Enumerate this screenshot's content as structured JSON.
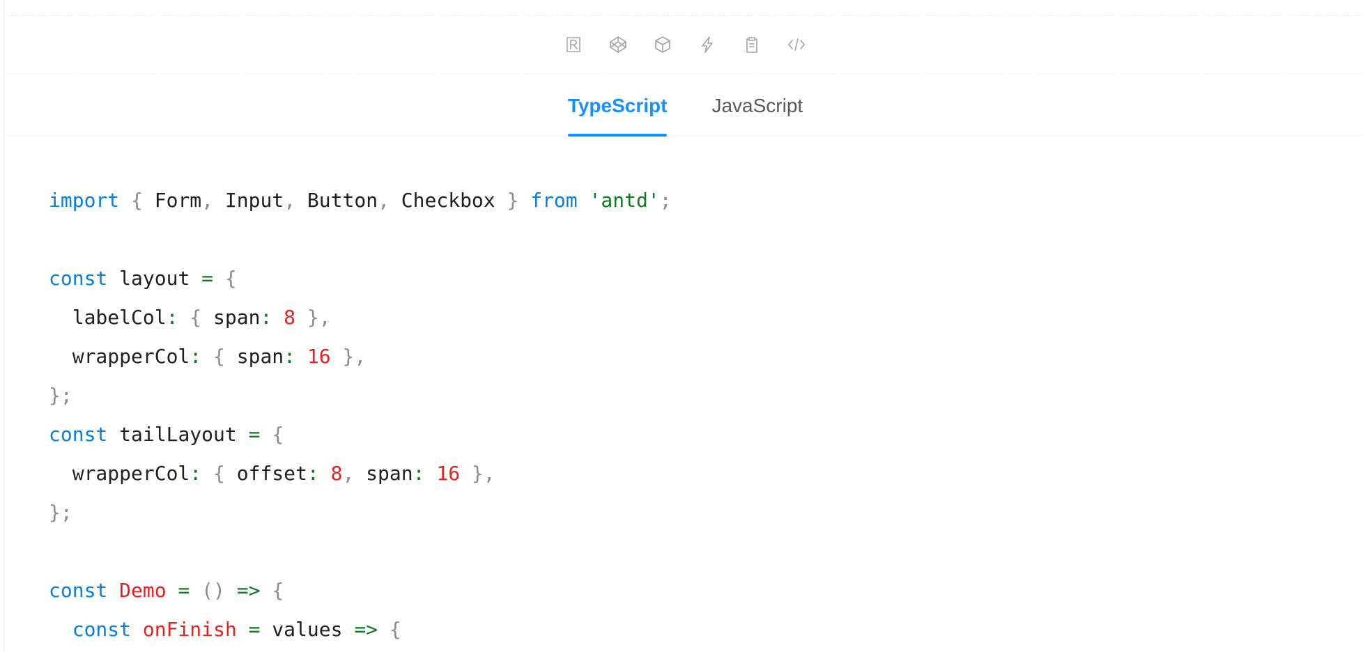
{
  "toolbar": {
    "icons": [
      {
        "name": "codesandbox-icon"
      },
      {
        "name": "codepen-icon"
      },
      {
        "name": "sandbox-box-icon"
      },
      {
        "name": "stackblitz-icon"
      },
      {
        "name": "copy-icon"
      },
      {
        "name": "code-toggle-icon"
      }
    ]
  },
  "tabs": [
    {
      "label": "TypeScript",
      "active": true
    },
    {
      "label": "JavaScript",
      "active": false
    }
  ],
  "code": {
    "language": "TypeScript",
    "lines": [
      [
        [
          "kw",
          "import"
        ],
        [
          "id",
          " "
        ],
        [
          "pun",
          "{"
        ],
        [
          "id",
          " Form"
        ],
        [
          "pun",
          ","
        ],
        [
          "id",
          " Input"
        ],
        [
          "pun",
          ","
        ],
        [
          "id",
          " Button"
        ],
        [
          "pun",
          ","
        ],
        [
          "id",
          " Checkbox "
        ],
        [
          "pun",
          "}"
        ],
        [
          "id",
          " "
        ],
        [
          "kw",
          "from"
        ],
        [
          "id",
          " "
        ],
        [
          "str",
          "'antd'"
        ],
        [
          "pun",
          ";"
        ]
      ],
      [],
      [
        [
          "kw",
          "const"
        ],
        [
          "id",
          " layout "
        ],
        [
          "op",
          "="
        ],
        [
          "id",
          " "
        ],
        [
          "pun",
          "{"
        ]
      ],
      [
        [
          "id",
          "  labelCol"
        ],
        [
          "op",
          ":"
        ],
        [
          "id",
          " "
        ],
        [
          "pun",
          "{"
        ],
        [
          "id",
          " span"
        ],
        [
          "op",
          ":"
        ],
        [
          "id",
          " "
        ],
        [
          "num",
          "8"
        ],
        [
          "id",
          " "
        ],
        [
          "pun",
          "},"
        ]
      ],
      [
        [
          "id",
          "  wrapperCol"
        ],
        [
          "op",
          ":"
        ],
        [
          "id",
          " "
        ],
        [
          "pun",
          "{"
        ],
        [
          "id",
          " span"
        ],
        [
          "op",
          ":"
        ],
        [
          "id",
          " "
        ],
        [
          "num",
          "16"
        ],
        [
          "id",
          " "
        ],
        [
          "pun",
          "},"
        ]
      ],
      [
        [
          "pun",
          "};"
        ]
      ],
      [
        [
          "kw",
          "const"
        ],
        [
          "id",
          " tailLayout "
        ],
        [
          "op",
          "="
        ],
        [
          "id",
          " "
        ],
        [
          "pun",
          "{"
        ]
      ],
      [
        [
          "id",
          "  wrapperCol"
        ],
        [
          "op",
          ":"
        ],
        [
          "id",
          " "
        ],
        [
          "pun",
          "{"
        ],
        [
          "id",
          " offset"
        ],
        [
          "op",
          ":"
        ],
        [
          "id",
          " "
        ],
        [
          "num",
          "8"
        ],
        [
          "pun",
          ","
        ],
        [
          "id",
          " span"
        ],
        [
          "op",
          ":"
        ],
        [
          "id",
          " "
        ],
        [
          "num",
          "16"
        ],
        [
          "id",
          " "
        ],
        [
          "pun",
          "},"
        ]
      ],
      [
        [
          "pun",
          "};"
        ]
      ],
      [],
      [
        [
          "kw",
          "const"
        ],
        [
          "id",
          " "
        ],
        [
          "fn",
          "Demo"
        ],
        [
          "id",
          " "
        ],
        [
          "op",
          "="
        ],
        [
          "id",
          " "
        ],
        [
          "pun",
          "()"
        ],
        [
          "id",
          " "
        ],
        [
          "op",
          "=>"
        ],
        [
          "id",
          " "
        ],
        [
          "pun",
          "{"
        ]
      ],
      [
        [
          "id",
          "  "
        ],
        [
          "kw",
          "const"
        ],
        [
          "id",
          " "
        ],
        [
          "fn",
          "onFinish"
        ],
        [
          "id",
          " "
        ],
        [
          "op",
          "="
        ],
        [
          "id",
          " values "
        ],
        [
          "op",
          "=>"
        ],
        [
          "id",
          " "
        ],
        [
          "pun",
          "{"
        ]
      ]
    ]
  }
}
